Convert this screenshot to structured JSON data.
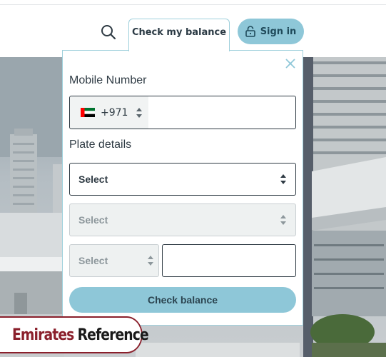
{
  "header": {
    "tab_label": "Check my balance",
    "signin_label": "Sign in"
  },
  "panel": {
    "mobile_label": "Mobile Number",
    "country_code": "+971",
    "mobile_value": "",
    "plate_label": "Plate details",
    "select_emirate": "Select",
    "select_category": "Select",
    "select_code": "Select",
    "plate_number_value": "",
    "submit_label": "Check balance"
  },
  "logo": {
    "part1": "Emirates",
    "part2": "Reference"
  },
  "colors": {
    "accent": "#8ec7d8",
    "border_active": "#2f3b44",
    "disabled_bg": "#eef1f1",
    "logo_red": "#8a1f2b"
  },
  "icons": [
    "search-icon",
    "lock-icon",
    "close-icon",
    "uae-flag-icon",
    "up-down-arrows-icon"
  ]
}
